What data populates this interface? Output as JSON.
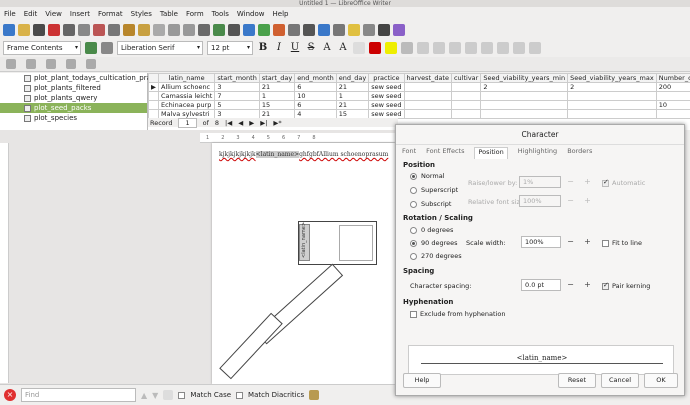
{
  "window": {
    "title": "Untitled 1 — LibreOffice Writer"
  },
  "menu": [
    "File",
    "Edit",
    "View",
    "Insert",
    "Format",
    "Styles",
    "Table",
    "Form",
    "Tools",
    "Window",
    "Help"
  ],
  "format_toolbar": {
    "paragraph_style": "Frame Contents",
    "font_name": "Liberation Serif",
    "font_size": "12 pt",
    "bold": "B",
    "italic": "I",
    "underline": "U",
    "strike": "S",
    "superscript": "A",
    "subscript": "A"
  },
  "data_sources": {
    "items": [
      {
        "label": "plot_plant_todays_cultication_practice",
        "selected": false
      },
      {
        "label": "plot_plants_filtered",
        "selected": false
      },
      {
        "label": "plot_plants_qwery",
        "selected": false
      },
      {
        "label": "plot_seed_packs",
        "selected": true
      },
      {
        "label": "plot_species",
        "selected": false
      }
    ]
  },
  "table": {
    "columns": [
      "latin_name",
      "start_month",
      "start_day",
      "end_month",
      "end_day",
      "practice",
      "harvest_date",
      "cultivar",
      "Seed_viability_years_min",
      "Seed_viability_years_max",
      "Number_of"
    ],
    "rows": [
      [
        "Allium schoenc",
        "3",
        "21",
        "6",
        "21",
        "sew seed",
        "",
        "",
        "2",
        "2",
        "200"
      ],
      [
        "Camassia leicht",
        "7",
        "1",
        "10",
        "1",
        "sew seed",
        "",
        "",
        "",
        "",
        ""
      ],
      [
        "Echinacea purp",
        "5",
        "15",
        "6",
        "21",
        "sew seed",
        "",
        "",
        "",
        "",
        "10"
      ],
      [
        "Malva sylvestri",
        "3",
        "21",
        "4",
        "15",
        "sew seed",
        "",
        "",
        "",
        "",
        ""
      ]
    ],
    "record_label": "Record",
    "record_num": "1",
    "record_of": "of",
    "record_total": "8"
  },
  "document": {
    "line_text": "kjkjkjkjkjkjk",
    "field": "<latin_name>",
    "line_tail": "ghfgbfAllium schoenoprasum",
    "rotated_field": "<latin_name>"
  },
  "find": {
    "placeholder": "Find",
    "match_case": "Match Case",
    "match_diacritics": "Match Diacritics"
  },
  "dialog": {
    "title": "Character",
    "tabs": [
      "Font",
      "Font Effects",
      "Position",
      "Highlighting",
      "Borders"
    ],
    "active_tab": "Position",
    "position_label": "Position",
    "normal": "Normal",
    "superscript": "Superscript",
    "subscript": "Subscript",
    "raise_lower_label": "Raise/lower by:",
    "raise_lower_value": "1%",
    "relative_font_label": "Relative font size:",
    "relative_font_value": "100%",
    "automatic": "Automatic",
    "rotation_label": "Rotation / Scaling",
    "deg0": "0 degrees",
    "deg90": "90 degrees",
    "deg270": "270 degrees",
    "scale_width_label": "Scale width:",
    "scale_width_value": "100%",
    "fit_to_line": "Fit to line",
    "spacing_label": "Spacing",
    "char_spacing_label": "Character spacing:",
    "char_spacing_value": "0.0 pt",
    "pair_kerning": "Pair kerning",
    "hyphenation_label": "Hyphenation",
    "exclude_hyphenation": "Exclude from hyphenation",
    "preview_text": "<latin_name>",
    "help": "Help",
    "reset": "Reset",
    "cancel": "Cancel",
    "ok": "OK"
  },
  "colors": {
    "selected_tree": "#8bb35a",
    "close_find": "#e03030"
  }
}
